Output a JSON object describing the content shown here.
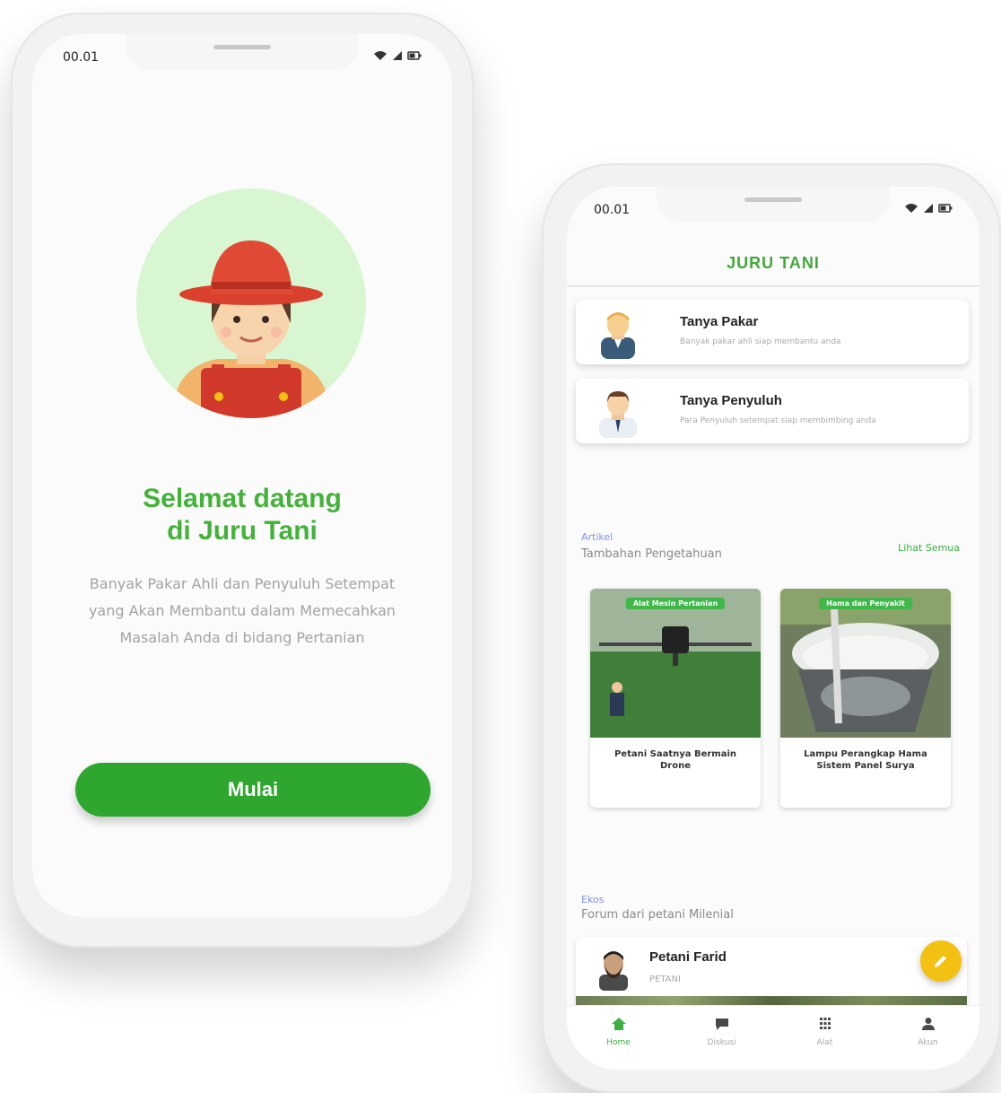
{
  "status_bar": {
    "time": "00.01"
  },
  "welcome": {
    "title_line1": "Selamat datang",
    "title_line2": "di Juru Tani",
    "description": "Banyak Pakar Ahli dan Penyuluh Setempat yang Akan Membantu dalam Memecahkan Masalah Anda di bidang Pertanian",
    "start_label": "Mulai"
  },
  "home": {
    "app_title": "JURU TANI",
    "menu": [
      {
        "title": "Tanya Pakar",
        "subtitle": "Banyak pakar ahli siap membantu anda"
      },
      {
        "title": "Tanya Penyuluh",
        "subtitle": "Para Penyuluh setempat siap membimbing anda"
      }
    ],
    "articles_section": {
      "label": "Artikel",
      "subtitle": "Tambahan Pengetahuan",
      "see_all": "Lihat Semua",
      "items": [
        {
          "tag": "Alat Mesin Pertanian",
          "title": "Petani Saatnya Bermain Drone"
        },
        {
          "tag": "Hama dan Penyakit",
          "title": "Lampu Perangkap Hama Sistem Panel Surya"
        }
      ]
    },
    "discussion_section": {
      "label": "Ekos",
      "subtitle": "Forum dari petani Milenial",
      "post": {
        "name": "Petani Farid",
        "role": "PETANI"
      }
    },
    "bottom_nav": [
      {
        "label": "Home",
        "icon": "home-icon"
      },
      {
        "label": "Diskusi",
        "icon": "chat-icon"
      },
      {
        "label": "Alat",
        "icon": "grid-icon"
      },
      {
        "label": "Akun",
        "icon": "user-icon"
      }
    ],
    "colors": {
      "brand_green": "#2fa72e",
      "accent_yellow": "#f3c112",
      "section_label": "#7f92e8"
    }
  }
}
